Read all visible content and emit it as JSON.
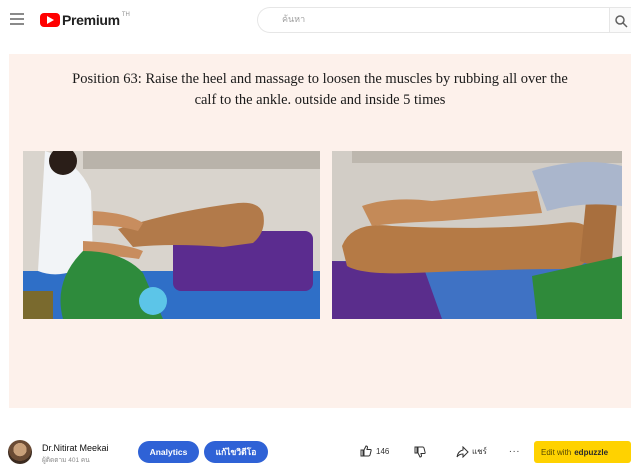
{
  "header": {
    "logo_text": "Premium",
    "logo_superscript": "TH",
    "search_placeholder": "ค้นหา"
  },
  "video": {
    "caption_line1": "Position 63: Raise the heel and massage to loosen the muscles by rubbing all over the",
    "caption_line2": "calf to the ankle. outside and inside 5 times"
  },
  "channel": {
    "name": "Dr.Nitirat Meekai",
    "subscribers": "ผู้ติดตาม 401 คน"
  },
  "actions": {
    "analytics_label": "Analytics",
    "edit_video_label": "แก้ไขวิดีโอ",
    "like_count": "146",
    "share_label": "แชร์",
    "more_label": "...",
    "edpuzzle_prefix": "Edit with",
    "edpuzzle_brand": "edpuzzle"
  },
  "colors": {
    "brand_red": "#ff0000",
    "button_blue": "#2f62d6",
    "edpuzzle_yellow": "#ffd200",
    "video_background": "#fdf1eb"
  }
}
